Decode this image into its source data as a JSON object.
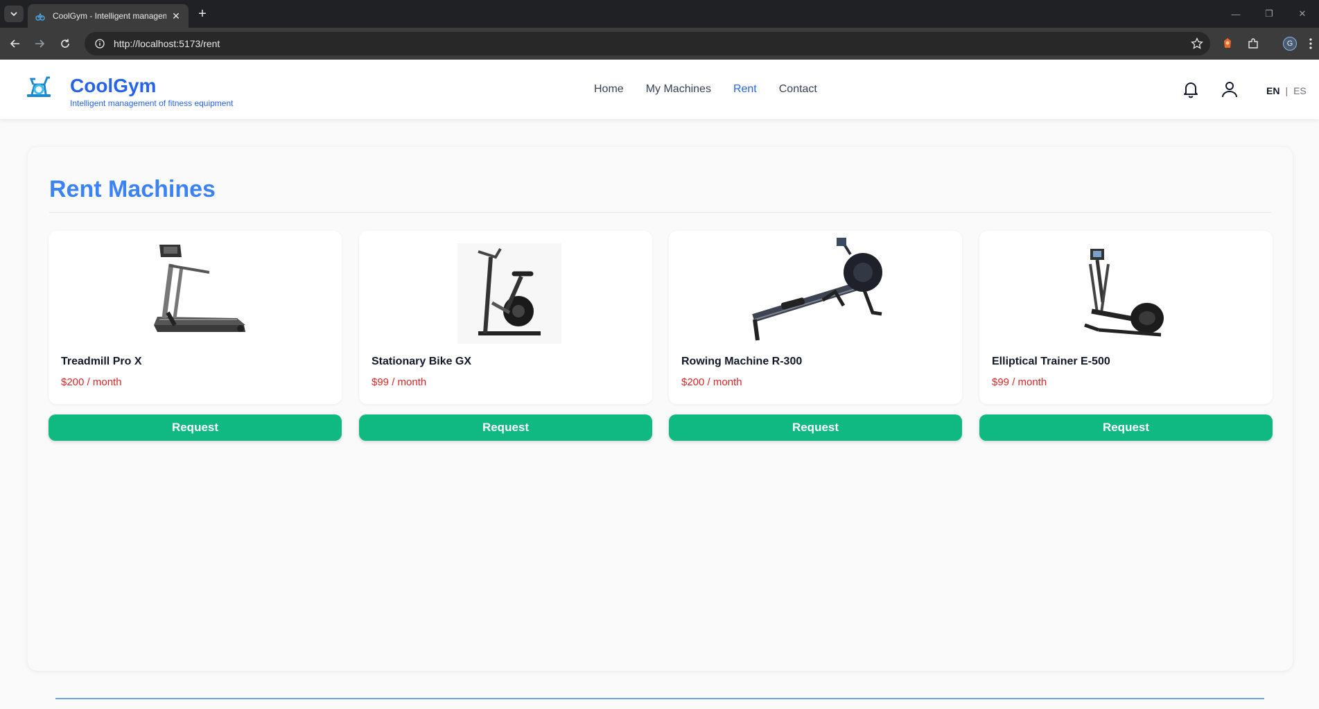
{
  "browser": {
    "tab_title": "CoolGym - Intelligent management of fitness equipment",
    "url": "http://localhost:5173/rent",
    "profile_initial": "G"
  },
  "header": {
    "brand_name": "CoolGym",
    "brand_tagline": "Intelligent management of fitness equipment",
    "nav": [
      "Home",
      "My Machines",
      "Rent",
      "Contact"
    ],
    "active_nav": "Rent",
    "lang": {
      "en": "EN",
      "separator": "|",
      "es": "ES",
      "active": "EN"
    }
  },
  "main": {
    "title": "Rent Machines",
    "machines": [
      {
        "name": "Treadmill Pro X",
        "price": "$200 / month",
        "image": "treadmill"
      },
      {
        "name": "Stationary Bike GX",
        "price": "$99 / month",
        "image": "stationary-bike"
      },
      {
        "name": "Rowing Machine R-300",
        "price": "$200 / month",
        "image": "rowing-machine"
      },
      {
        "name": "Elliptical Trainer E-500",
        "price": "$99 / month",
        "image": "elliptical-trainer"
      }
    ],
    "request_label": "Request"
  },
  "colors": {
    "brand": "#2563eb",
    "title": "#3b82f6",
    "price": "#dc2626",
    "button": "#10b981"
  }
}
